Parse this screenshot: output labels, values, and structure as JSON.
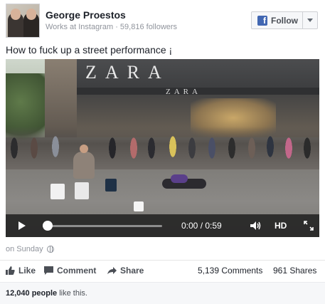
{
  "post": {
    "author": "George Proestos",
    "subtitle": "Works at Instagram · 59,816 followers",
    "follow_label": "Follow",
    "text": "How to fuck up a street performance ¡",
    "timestamp": "on Sunday"
  },
  "video": {
    "store_sign": "ZARA",
    "store_sign_small": "ZARA",
    "time": "0:00 / 0:59",
    "quality": "HD",
    "progress": 0.0
  },
  "actions": {
    "like": "Like",
    "comment": "Comment",
    "share": "Share"
  },
  "stats": {
    "comments": "5,139 Comments",
    "shares": "961 Shares",
    "likes_count": "12,040 people",
    "likes_suffix": " like this."
  },
  "icons": {
    "facebook": "facebook-f-icon",
    "play": "play-icon",
    "volume": "volume-icon",
    "fullscreen": "fullscreen-icon",
    "globe": "globe-icon",
    "like": "thumbs-up-icon",
    "comment": "comment-icon",
    "share": "share-arrow-icon"
  },
  "colors": {
    "facebook_blue": "#4267b2",
    "text_primary": "#1d2129",
    "text_secondary": "#90949c"
  }
}
